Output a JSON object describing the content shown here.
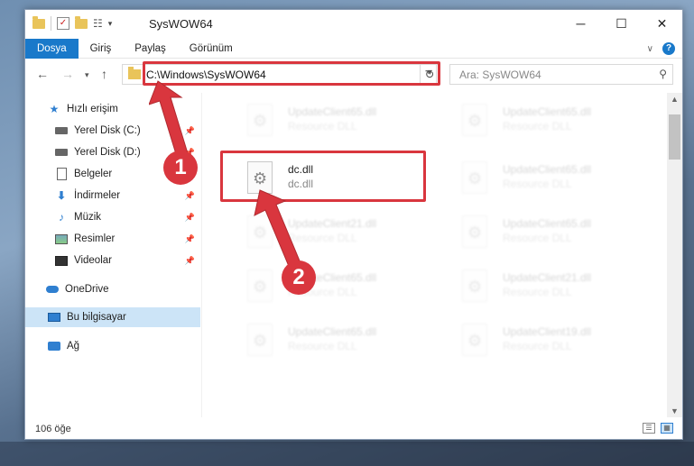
{
  "window": {
    "title": "SysWOW64",
    "controls": {
      "minimize": "─",
      "maximize": "☐",
      "close": "✕"
    }
  },
  "ribbon": {
    "tabs": [
      {
        "label": "Dosya",
        "active": true
      },
      {
        "label": "Giriş"
      },
      {
        "label": "Paylaş"
      },
      {
        "label": "Görünüm"
      }
    ]
  },
  "navigation": {
    "address": "C:\\Windows\\SysWOW64",
    "search_placeholder": "Ara: SysWOW64"
  },
  "sidebar": {
    "items": [
      {
        "label": "Hızlı erişim",
        "icon": "star-icon"
      },
      {
        "label": "Yerel Disk (C:)",
        "icon": "disk-icon",
        "pinned": true
      },
      {
        "label": "Yerel Disk (D:)",
        "icon": "disk-icon",
        "pinned": true
      },
      {
        "label": "Belgeler",
        "icon": "document-icon",
        "pinned": true
      },
      {
        "label": "İndirmeler",
        "icon": "download-icon",
        "pinned": true
      },
      {
        "label": "Müzik",
        "icon": "music-icon",
        "pinned": true
      },
      {
        "label": "Resimler",
        "icon": "pictures-icon",
        "pinned": true
      },
      {
        "label": "Videolar",
        "icon": "video-icon",
        "pinned": true
      },
      {
        "label": "OneDrive",
        "icon": "cloud-icon"
      },
      {
        "label": "Bu bilgisayar",
        "icon": "computer-icon",
        "selected": true
      },
      {
        "label": "Ağ",
        "icon": "network-icon"
      }
    ]
  },
  "files": [
    {
      "name": "UpdateClient65.dll",
      "type": "Resource DLL",
      "faded": true
    },
    {
      "name": "UpdateClient65.dll",
      "type": "Resource DLL",
      "faded": true
    },
    {
      "name": "dc.dll",
      "type": "dc.dll",
      "faded": false
    },
    {
      "name": "UpdateClient65.dll",
      "type": "Resource DLL",
      "faded": true
    },
    {
      "name": "UpdateClient21.dll",
      "type": "Resource DLL",
      "faded": true
    },
    {
      "name": "UpdateClient65.dll",
      "type": "Resource DLL",
      "faded": true
    },
    {
      "name": "UpdateClient65.dll",
      "type": "Resource DLL",
      "faded": true
    },
    {
      "name": "UpdateClient21.dll",
      "type": "Resource DLL",
      "faded": true
    },
    {
      "name": "UpdateClient65.dll",
      "type": "Resource DLL",
      "faded": true
    },
    {
      "name": "UpdateClient19.dll",
      "type": "Resource DLL",
      "faded": true
    }
  ],
  "status": {
    "item_count": "106 öğe"
  },
  "callouts": {
    "first": "1",
    "second": "2"
  },
  "colors": {
    "accent": "#1979ca",
    "highlight": "#d9363e",
    "selection": "#cce4f7"
  }
}
